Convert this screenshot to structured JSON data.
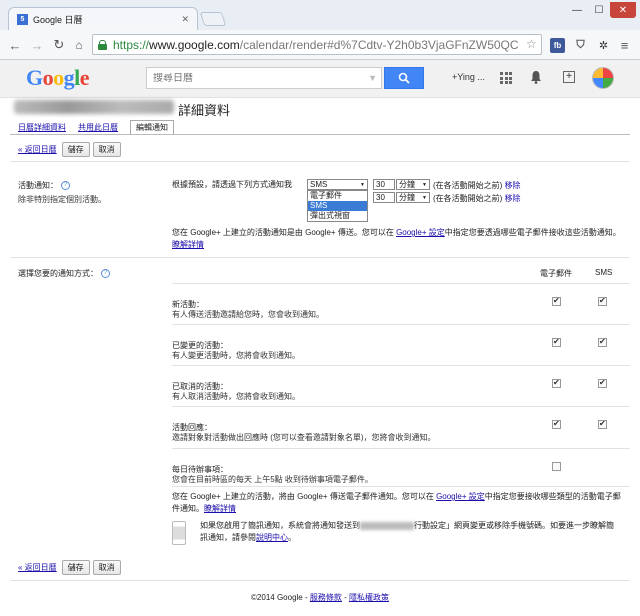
{
  "browser": {
    "tab_title": "Google 日曆",
    "tab_favicon": "5",
    "url_scheme": "https://",
    "url_host": "www.google.com",
    "url_path": "/calendar/render#d%7Cdtv-Y2h0b3VjaGFnZW50QC",
    "ext_label": "fb"
  },
  "gbar": {
    "logo": "Google",
    "search_placeholder": "搜尋日曆",
    "user": "+Ying ...",
    "brand_blue": "#4285f4"
  },
  "page": {
    "title": "詳細資料",
    "tabs": [
      "日曆詳細資料",
      "共用此日曆",
      "編輯通知"
    ],
    "back_link": "« 返回日曆",
    "save": "儲存",
    "cancel": "取消"
  },
  "event_reminders": {
    "label": "活動通知：",
    "sub": "除非特別指定個別活動。",
    "default_text": "根據預設，請透過下列方式通知我",
    "rows": [
      {
        "method": "SMS",
        "amount": "30",
        "unit": "分鐘",
        "note": "(在各活動開始之前)",
        "remove": "移除"
      },
      {
        "method": "SMS",
        "amount": "30",
        "unit": "分鐘",
        "note": "(在各活動開始之前)",
        "remove": "移除"
      }
    ],
    "dropdown_options": [
      "電子郵件",
      "SMS",
      "彈出式視窗"
    ],
    "info_pre": "您在 Google+ 上建立的活動通知是由 Google+ 傳送。您可以在 ",
    "info_link1": "Google+ 設定",
    "info_mid": "中指定您要透過哪些電子郵件接收這些活動通知。",
    "info_link2": "瞭解詳情"
  },
  "notification_methods": {
    "label": "選擇您要的通知方式：",
    "col_email": "電子郵件",
    "col_sms": "SMS",
    "items": [
      {
        "title": "新活動：",
        "desc": "有人傳送活動邀請給您時，您會收到通知。",
        "email": true,
        "sms": true
      },
      {
        "title": "已變更的活動：",
        "desc": "有人變更活動時，您將會收到通知。",
        "email": true,
        "sms": true
      },
      {
        "title": "已取消的活動：",
        "desc": "有人取消活動時，您將會收到通知。",
        "email": true,
        "sms": true
      },
      {
        "title": "活動回應：",
        "desc": "邀請對象對活動做出回應時 (您可以查看邀請對象名單)，您將會收到通知。",
        "email": true,
        "sms": true
      },
      {
        "title": "每日待辦事項：",
        "desc": "您會在目前時區的每天 上午5點 收到待辦事項電子郵件。",
        "email": false,
        "sms": null
      }
    ],
    "gplus_pre": "您在 Google+ 上建立的活動，將由 Google+ 傳送電子郵件通知。您可以在 ",
    "gplus_link1": "Google+ 設定",
    "gplus_mid": "中指定您要接收哪些類型的活動電子郵件通知。",
    "gplus_link2": "瞭解詳情",
    "mobile_pre": "如果您啟用了簡訊通知，系統會將通知發送到",
    "mobile_mid": "行動設定」網頁變更或移除手機號碼。如要進一步瞭解簡訊通知，請參閱",
    "mobile_link": "說明中心",
    "mobile_end": "。"
  },
  "footer": {
    "copyright": "©2014 Google - ",
    "terms": "服務條款",
    "sep": " - ",
    "privacy": "隱私權政策"
  }
}
